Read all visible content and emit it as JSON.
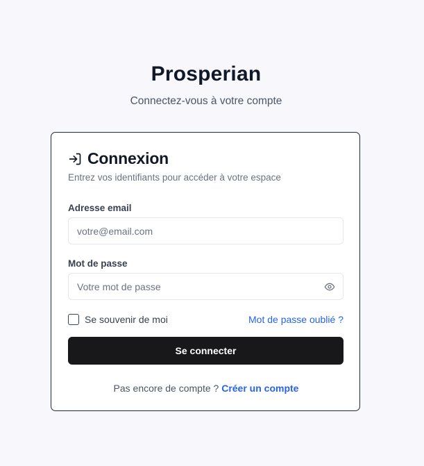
{
  "header": {
    "app_name": "Prosperian",
    "tagline": "Connectez-vous à votre compte"
  },
  "card": {
    "icon": "login-icon",
    "title": "Connexion",
    "subtitle": "Entrez vos identifiants pour accéder à votre espace"
  },
  "form": {
    "email": {
      "label": "Adresse email",
      "value": "",
      "placeholder": "votre@email.com"
    },
    "password": {
      "label": "Mot de passe",
      "value": "",
      "placeholder": "Votre mot de passe",
      "toggle_icon": "eye-icon"
    },
    "remember": {
      "label": "Se souvenir de moi",
      "checked": false
    },
    "forgot_link": "Mot de passe oublié ?",
    "submit_label": "Se connecter"
  },
  "footer": {
    "prompt": "Pas encore de compte ?",
    "signup_link": "Créer un compte"
  },
  "colors": {
    "background": "#f8f8fc",
    "primary_button": "#18181b",
    "link": "#2563eb"
  }
}
